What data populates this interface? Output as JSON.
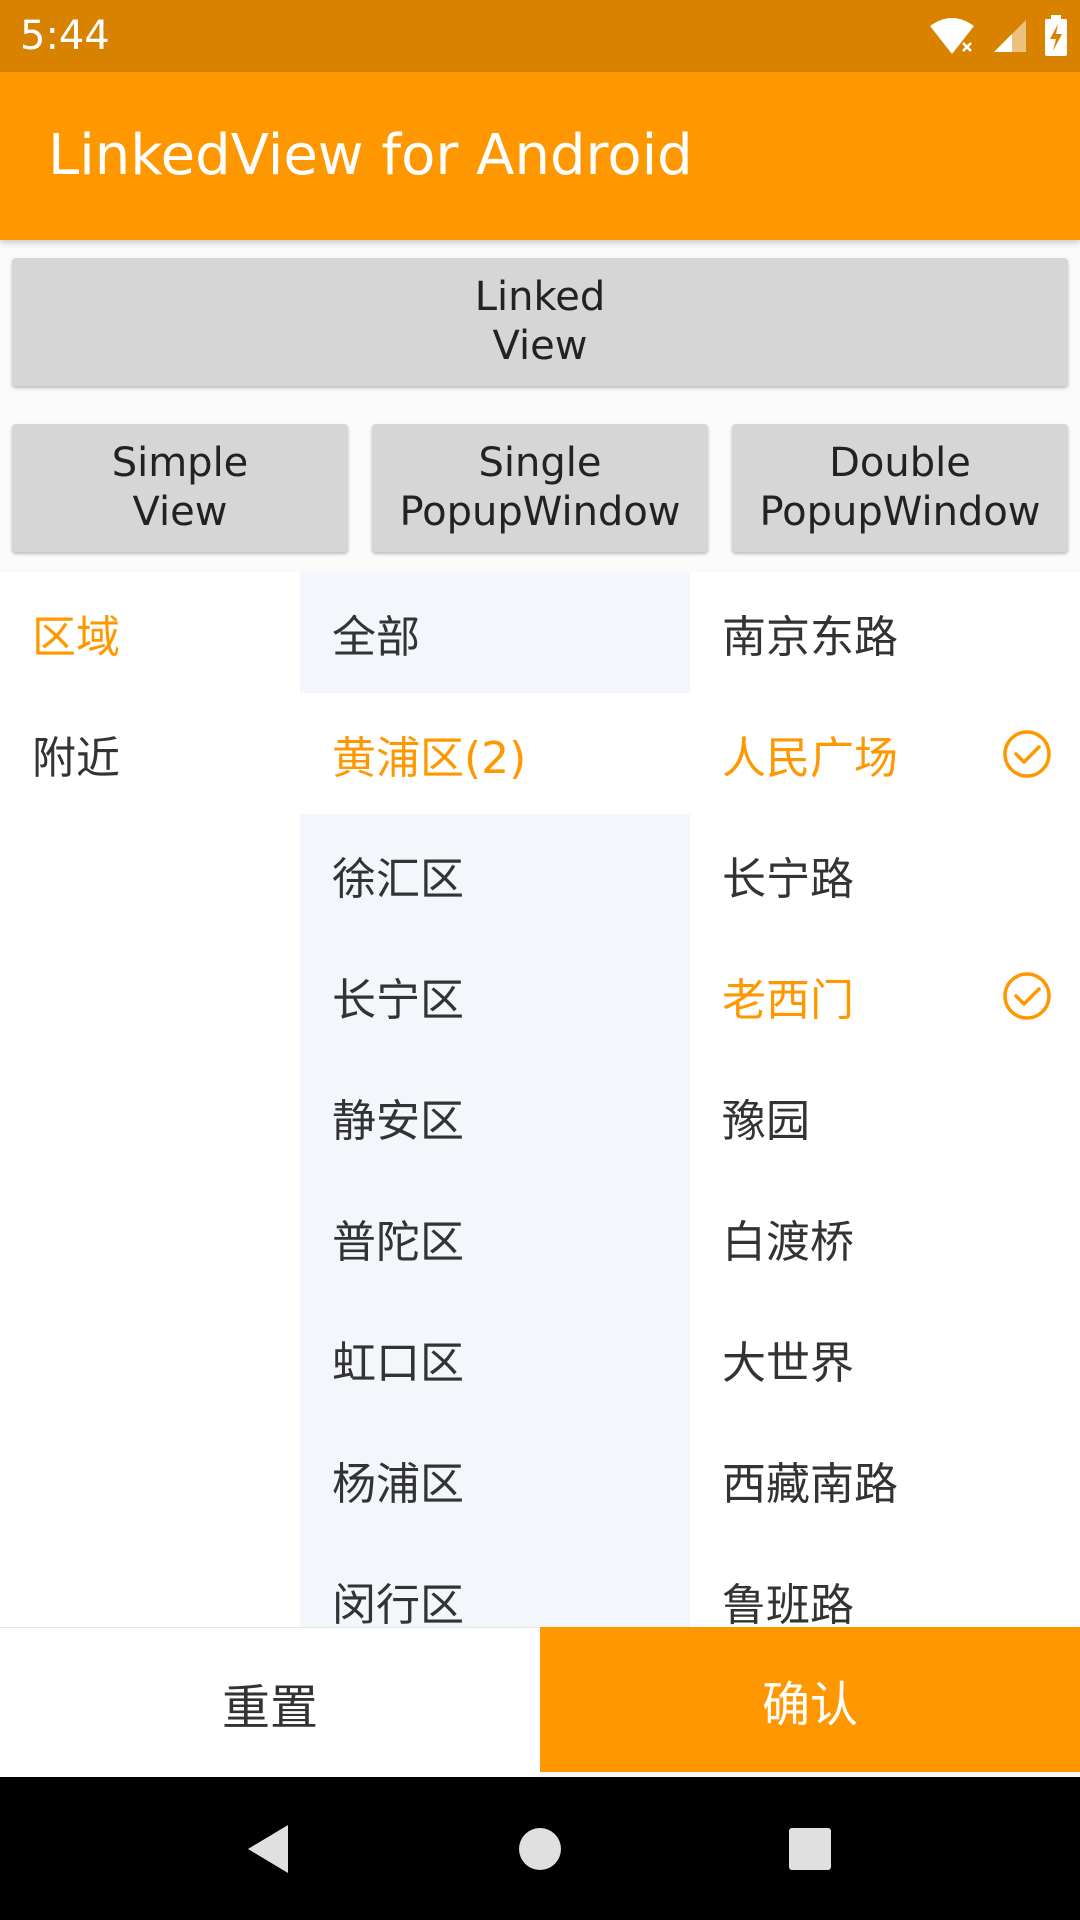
{
  "status_bar": {
    "time": "5:44"
  },
  "app_bar": {
    "title": "LinkedView for Android"
  },
  "buttons": {
    "linked": [
      "Linked",
      "View"
    ],
    "simple": [
      "Simple",
      "View"
    ],
    "single": [
      "Single",
      "PopupWindow"
    ],
    "double": [
      "Double",
      "PopupWindow"
    ]
  },
  "linked_view": {
    "categories": [
      {
        "label": "区域",
        "selected": true
      },
      {
        "label": "附近",
        "selected": false
      }
    ],
    "districts": [
      {
        "label": "全部",
        "selected": false
      },
      {
        "label": "黄浦区(2)",
        "selected": true
      },
      {
        "label": "徐汇区",
        "selected": false
      },
      {
        "label": "长宁区",
        "selected": false
      },
      {
        "label": "静安区",
        "selected": false
      },
      {
        "label": "普陀区",
        "selected": false
      },
      {
        "label": "虹口区",
        "selected": false
      },
      {
        "label": "杨浦区",
        "selected": false
      },
      {
        "label": "闵行区",
        "selected": false
      }
    ],
    "places": [
      {
        "label": "南京东路",
        "checked": false
      },
      {
        "label": "人民广场",
        "checked": true
      },
      {
        "label": "长宁路",
        "checked": false
      },
      {
        "label": "老西门",
        "checked": true
      },
      {
        "label": "豫园",
        "checked": false
      },
      {
        "label": "白渡桥",
        "checked": false
      },
      {
        "label": "大世界",
        "checked": false
      },
      {
        "label": "西藏南路",
        "checked": false
      },
      {
        "label": "鲁班路",
        "checked": false
      }
    ]
  },
  "actions": {
    "reset": "重置",
    "confirm": "确认"
  },
  "colors": {
    "accent": "#ff9800",
    "status_bar": "#d88200",
    "mid_column_bg": "#f3f6fb",
    "button_bg": "#d6d6d6"
  }
}
